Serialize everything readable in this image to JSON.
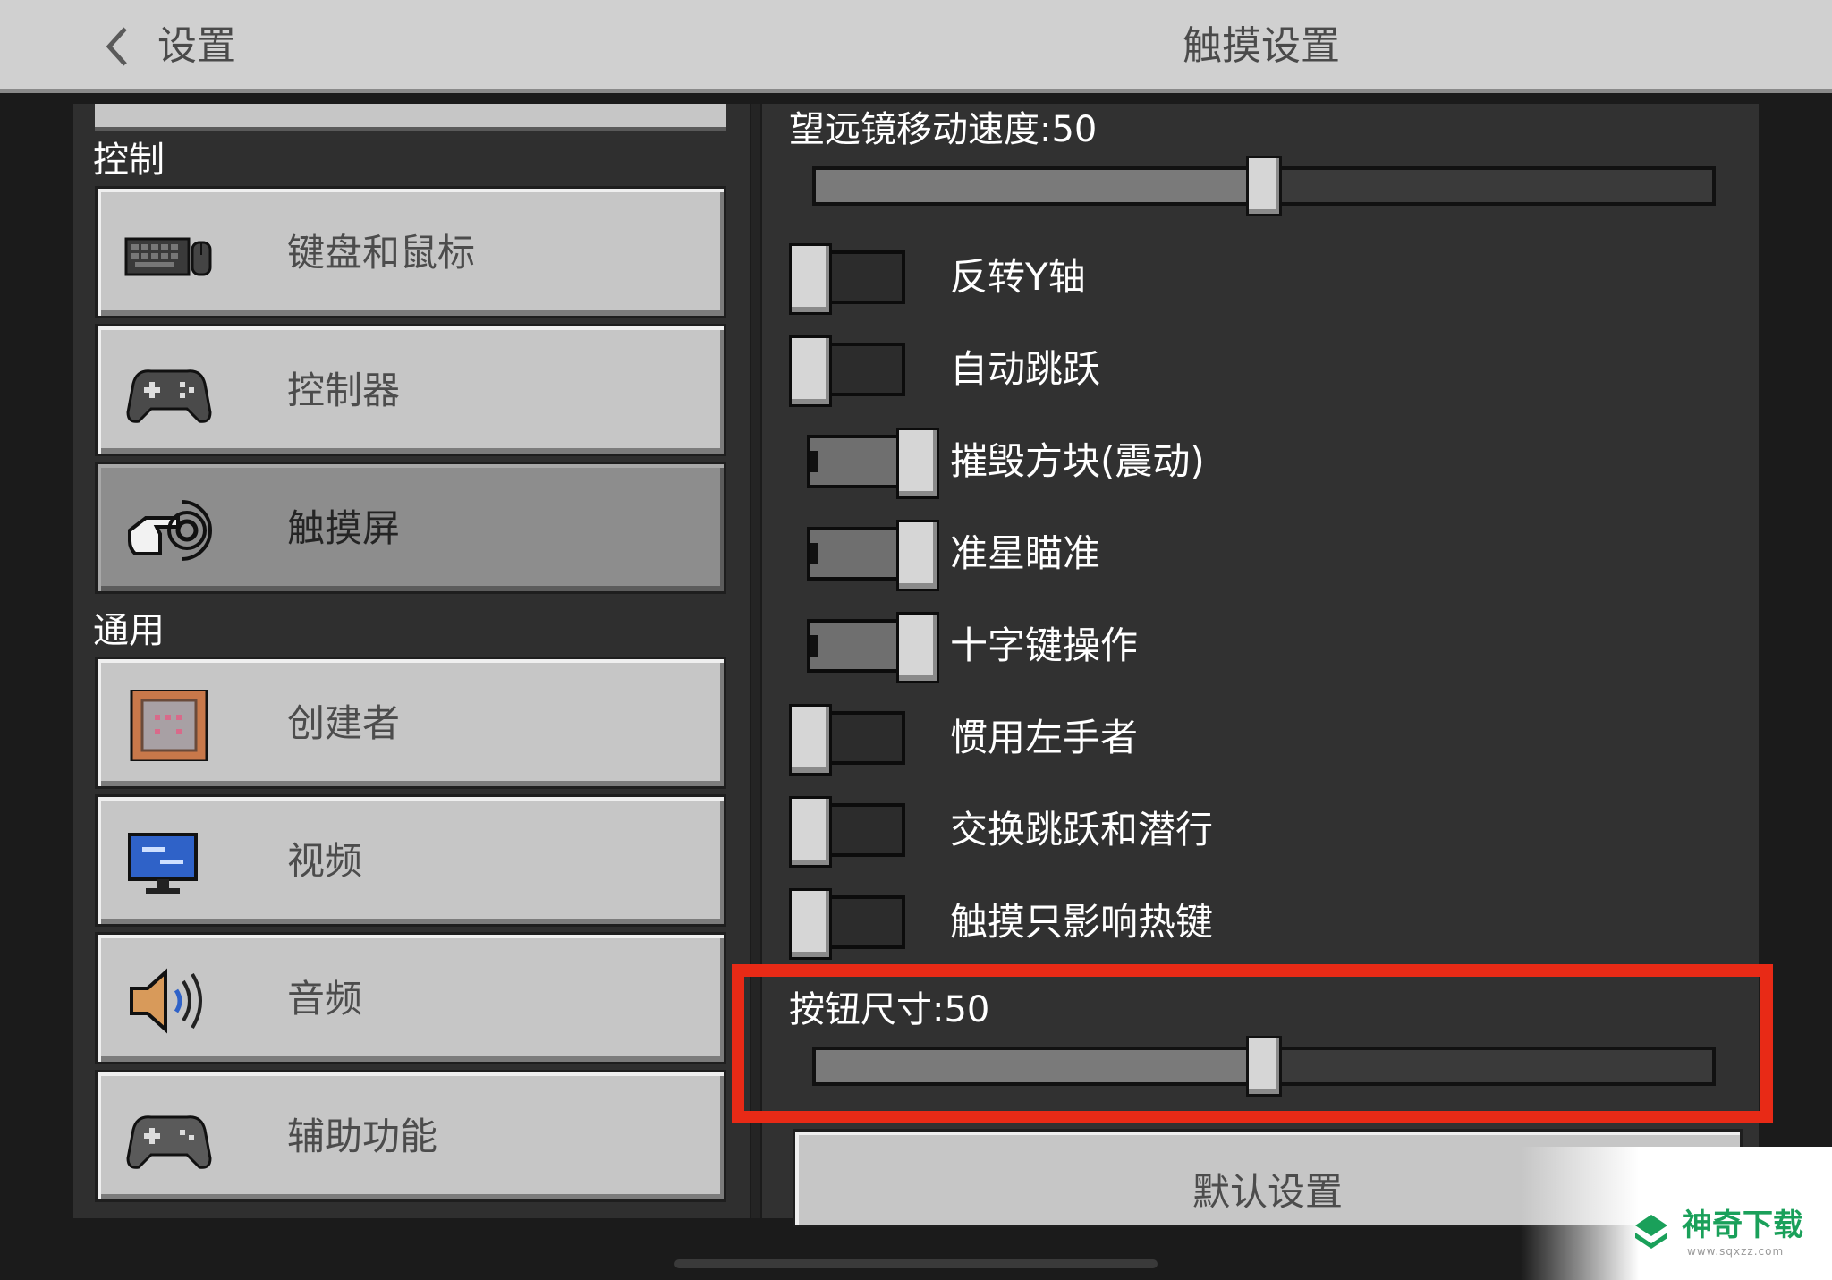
{
  "header": {
    "back_label": "设置",
    "title": "触摸设置"
  },
  "sidebar": {
    "sections": [
      {
        "title": "控制",
        "items": [
          {
            "label": "键盘和鼠标",
            "icon": "keyboard-mouse-icon",
            "active": false
          },
          {
            "label": "控制器",
            "icon": "gamepad-icon",
            "active": false
          },
          {
            "label": "触摸屏",
            "icon": "touch-hand-icon",
            "active": true
          }
        ]
      },
      {
        "title": "通用",
        "items": [
          {
            "label": "创建者",
            "icon": "command-block-icon",
            "active": false
          },
          {
            "label": "视频",
            "icon": "monitor-icon",
            "active": false
          },
          {
            "label": "音频",
            "icon": "speaker-icon",
            "active": false
          },
          {
            "label": "辅助功能",
            "icon": "gamepad-icon",
            "active": false
          }
        ]
      }
    ]
  },
  "settings": {
    "telescope_speed": {
      "label": "望远镜移动速度:50",
      "value": 50,
      "max": 100
    },
    "toggles": [
      {
        "label": "反转Y轴",
        "on": false
      },
      {
        "label": "自动跳跃",
        "on": false
      },
      {
        "label": "摧毁方块(震动)",
        "on": true
      },
      {
        "label": "准星瞄准",
        "on": true
      },
      {
        "label": "十字键操作",
        "on": true
      },
      {
        "label": "惯用左手者",
        "on": false
      },
      {
        "label": "交换跳跃和潜行",
        "on": false
      },
      {
        "label": "触摸只影响热键",
        "on": false
      }
    ],
    "button_size": {
      "label": "按钮尺寸:50",
      "value": 50,
      "max": 100
    },
    "default_button": "默认设置"
  },
  "watermark": {
    "text": "神奇下载",
    "url": "www.sqxzz.com"
  },
  "colors": {
    "highlight": "#e82a16",
    "watermark_green": "#1aa05a"
  }
}
